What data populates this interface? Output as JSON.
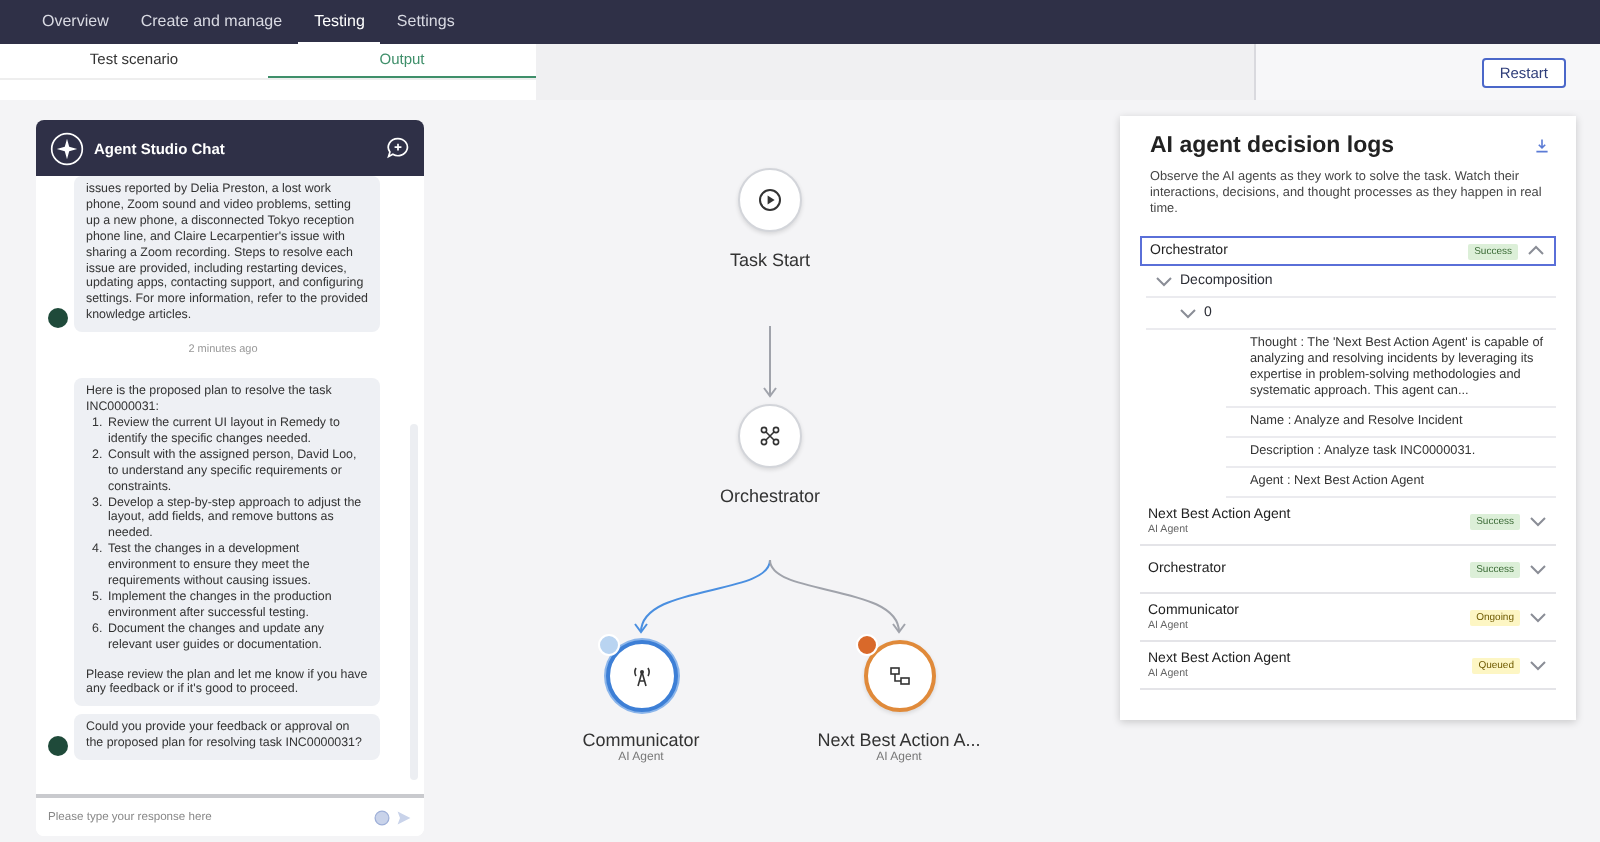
{
  "top_tabs": [
    {
      "label": "Overview",
      "selected": false
    },
    {
      "label": "Create and manage",
      "selected": false
    },
    {
      "label": "Testing",
      "selected": true
    },
    {
      "label": "Settings",
      "selected": false
    }
  ],
  "sub_tabs": [
    {
      "label": "Test scenario",
      "selected": false
    },
    {
      "label": "Output",
      "selected": true
    }
  ],
  "restart_button": "Restart",
  "chat": {
    "title": "Agent Studio Chat",
    "messages": [
      {
        "kind": "text",
        "avatar": true,
        "text": "issues reported by Delia Preston, a lost work phone, Zoom sound and video problems, setting up a new phone, a disconnected Tokyo reception phone line, and Claire Lecarpentier's issue with sharing a Zoom recording. Steps to resolve each issue are provided, including restarting devices, updating apps, contacting support, and configuring settings. For more information, refer to the provided knowledge articles."
      },
      {
        "kind": "time",
        "text": "2 minutes ago"
      },
      {
        "kind": "plan",
        "avatar": false,
        "intro": "Here is the proposed plan to resolve the task INC0000031:",
        "steps": [
          {
            "number": "1.",
            "text": "Review the current UI layout in Remedy to identify the specific changes needed."
          },
          {
            "number": "2.",
            "text": "Consult with the assigned person, David Loo, to understand any specific requirements or constraints."
          },
          {
            "number": "3.",
            "text": "Develop a step-by-step approach to adjust the layout, add fields, and remove buttons as needed."
          },
          {
            "number": "4.",
            "text": "Test the changes in a development environment to ensure they meet the requirements without causing issues."
          },
          {
            "number": "5.",
            "text": "Implement the changes in the production environment after successful testing."
          },
          {
            "number": "6.",
            "text": "Document the changes and update any relevant user guides or documentation."
          }
        ],
        "outro": "Please review the plan and let me know if you have any feedback or if it's good to proceed."
      },
      {
        "kind": "text",
        "avatar": true,
        "text": "Could you provide your feedback or approval on the proposed plan for resolving task INC0000031?"
      }
    ],
    "input": {
      "placeholder": "Please type your response here"
    }
  },
  "flow": {
    "nodes": [
      {
        "kind": "start",
        "name": "Task Start",
        "active": false,
        "blocked": false
      },
      {
        "kind": "orchestrator",
        "name": "Orchestrator",
        "active": false,
        "blocked": false
      },
      {
        "kind": "agent",
        "name": "Communicator",
        "subtitle": "AI Agent",
        "active": true,
        "blocked": false
      },
      {
        "kind": "tool",
        "name": "Next Best Action A...",
        "subtitle": "AI Agent",
        "active": false,
        "blocked": true
      }
    ]
  },
  "logs": {
    "title": "AI agent decision logs",
    "description": "Observe the AI agents as they work to solve the task. Watch their interactions, decisions, and thought processes as they happen in real time.",
    "items": [
      {
        "name": "Orchestrator",
        "selected": true,
        "expanded": true,
        "status": {
          "label": "Success",
          "kind": "success"
        },
        "children": [
          {
            "label": "Decomposition",
            "expanded": true,
            "children": [
              {
                "label": "0",
                "expanded": true,
                "children": [
                  {
                    "label": "Thought : The 'Next Best Action Agent' is capable of analyzing and resolving incidents by leveraging its expertise in problem-solving methodologies and systematic approach. This agent can..."
                  },
                  {
                    "label": "Name : Analyze and Resolve Incident"
                  },
                  {
                    "label": "Description : Analyze task INC0000031."
                  },
                  {
                    "label": "Agent : Next Best Action Agent"
                  }
                ]
              }
            ]
          }
        ]
      },
      {
        "name": "Next Best Action Agent",
        "subtitle": "AI Agent",
        "selected": false,
        "expanded": false,
        "status": {
          "label": "Success",
          "kind": "success"
        }
      },
      {
        "name": "Orchestrator",
        "selected": false,
        "expanded": false,
        "status": {
          "label": "Success",
          "kind": "success"
        }
      },
      {
        "name": "Communicator",
        "subtitle": "AI Agent",
        "selected": false,
        "expanded": false,
        "status": {
          "label": "Ongoing",
          "kind": "ongoing"
        }
      },
      {
        "name": "Next Best Action Agent",
        "subtitle": "AI Agent",
        "selected": false,
        "expanded": false,
        "status": {
          "label": "Queued",
          "kind": "queued"
        }
      }
    ]
  }
}
